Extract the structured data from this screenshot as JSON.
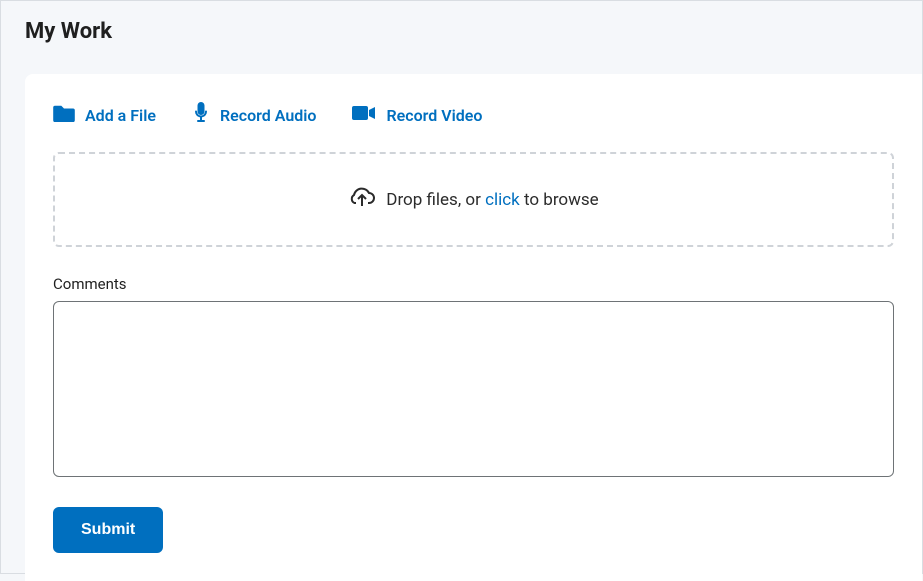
{
  "header": {
    "title": "My Work"
  },
  "actions": {
    "add_file": "Add a File",
    "record_audio": "Record Audio",
    "record_video": "Record Video"
  },
  "dropzone": {
    "prefix": "Drop files, or ",
    "link": "click",
    "suffix": " to browse"
  },
  "comments": {
    "label": "Comments",
    "value": ""
  },
  "submit": {
    "label": "Submit"
  }
}
